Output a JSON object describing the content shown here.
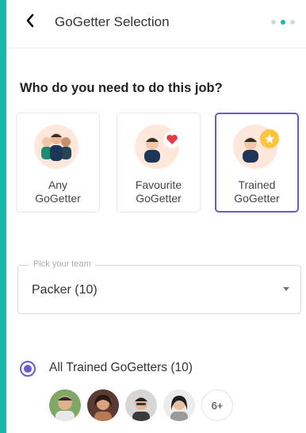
{
  "header": {
    "title": "GoGetter Selection",
    "back_icon": "chevron-left-icon",
    "step_dots": 3,
    "active_step": 2
  },
  "question": "Who do you need to do this job?",
  "options": [
    {
      "label_line1": "Any",
      "label_line2": "GoGetter",
      "icon": "group-avatar-icon",
      "selected": false
    },
    {
      "label_line1": "Favourite",
      "label_line2": "GoGetter",
      "icon": "heart-icon",
      "selected": false
    },
    {
      "label_line1": "Trained",
      "label_line2": "GoGetter",
      "icon": "star-icon",
      "selected": true
    }
  ],
  "team_picker": {
    "legend": "Pick your team",
    "value": "Packer (10)"
  },
  "trained_filter": {
    "label": "All Trained GoGetters (10)",
    "selected": true
  },
  "members": {
    "more_label": "6+"
  },
  "colors": {
    "accent": "#18b7ab",
    "selected": "#6a5acd",
    "star": "#ffc43d",
    "heart": "#e53945"
  }
}
